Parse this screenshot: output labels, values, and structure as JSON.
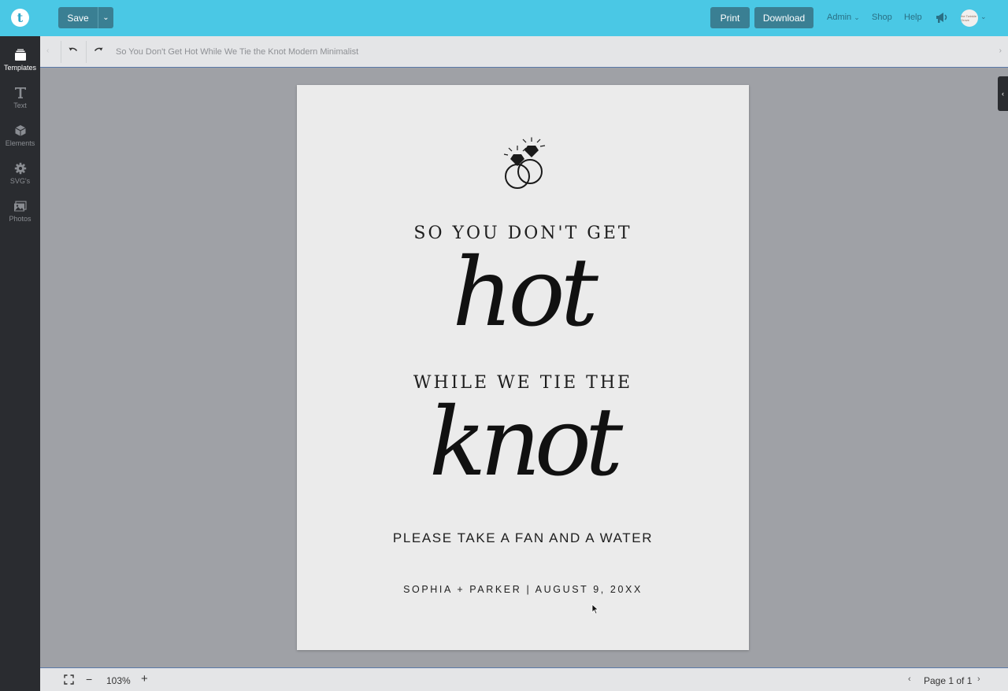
{
  "header": {
    "logo": "t",
    "save_label": "Save",
    "print_label": "Print",
    "download_label": "Download",
    "nav": {
      "admin": "Admin",
      "shop": "Shop",
      "help": "Help"
    },
    "avatar_text": "the Twinkle Grove"
  },
  "sidebar": {
    "items": [
      {
        "label": "Templates",
        "icon": "layers-icon"
      },
      {
        "label": "Text",
        "icon": "text-icon"
      },
      {
        "label": "Elements",
        "icon": "cube-icon"
      },
      {
        "label": "SVG's",
        "icon": "gear-icon"
      },
      {
        "label": "Photos",
        "icon": "photo-icon"
      }
    ]
  },
  "toolbar": {
    "document_title": "So You Don't Get Hot While We Tie the Knot Modern Minimalist"
  },
  "page": {
    "line1": "SO YOU DON'T GET",
    "script1": "hot",
    "line2": "WHILE WE TIE THE",
    "script2": "knot",
    "line3": "PLEASE TAKE A FAN AND A WATER",
    "line4": "SOPHIA + PARKER | AUGUST 9, 20XX"
  },
  "footer": {
    "zoom": "103%",
    "page_indicator": "Page 1 of 1"
  },
  "colors": {
    "topbar": "#4ac8e5",
    "button": "#3a7f93",
    "sidebar": "#2a2c30",
    "workspace": "#9fa1a6",
    "page": "#ebebeb"
  }
}
